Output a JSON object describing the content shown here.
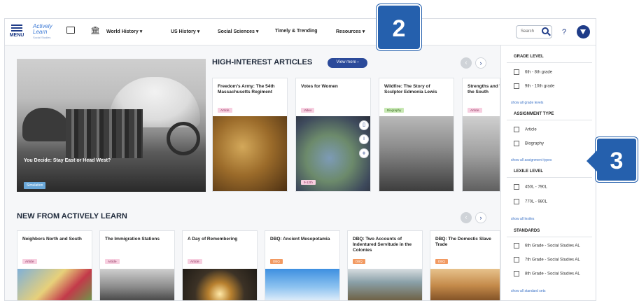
{
  "navbar": {
    "menu_label": "MENU",
    "logo_line1": "Actively",
    "logo_line2": "Learn",
    "logo_sub": "Social Studies",
    "links": [
      "World History ▾",
      "US History ▾",
      "Social Sciences ▾",
      "Timely & Trending",
      "Resources ▾"
    ],
    "search_placeholder": "Search",
    "help": "?"
  },
  "hero": {
    "title": "You Decide: Stay East or Head West?",
    "tag": "Simulation"
  },
  "high_interest": {
    "title": "HIGH-INTEREST ARTICLES",
    "view_more": "View more  ›",
    "prev": "‹",
    "next": "›",
    "cards": [
      {
        "title": "Freedom's Army: The 54th Massachusetts Regiment",
        "tag": "Article"
      },
      {
        "title": "Votes for Women",
        "tag": "Video",
        "grade": "9-12th"
      },
      {
        "title": "Wildfire: The Story of Sculptor Edmonia Lewis",
        "tag": "Biography"
      },
      {
        "title": "Strengths and Weaknesses of the South",
        "tag": "Article"
      }
    ]
  },
  "new_from": {
    "title": "NEW FROM ACTIVELY LEARN",
    "prev": "‹",
    "next": "›",
    "cards": [
      {
        "title": "Neighbors North and South",
        "tag": "Article"
      },
      {
        "title": "The Immigration Stations",
        "tag": "Article"
      },
      {
        "title": "A Day of Remembering",
        "tag": "Article"
      },
      {
        "title": "DBQ: Ancient Mesopotamia",
        "tag": "DBQ"
      },
      {
        "title": "DBQ: Two Accounts of Indentured Servitude in the Colonies",
        "tag": "DBQ"
      },
      {
        "title": "DBQ: The Domestic Slave Trade",
        "tag": "DBQ"
      }
    ]
  },
  "sidebar": {
    "grade": {
      "head": "GRADE LEVEL",
      "items": [
        "6th - 8th grade",
        "9th - 10th grade"
      ],
      "link": "show all grade levels"
    },
    "type": {
      "head": "ASSIGNMENT TYPE",
      "items": [
        "Article",
        "Biography"
      ],
      "link": "show all assignment types"
    },
    "lexile": {
      "head": "LEXILE LEVEL",
      "items": [
        "450L - 790L",
        "770L - 980L"
      ],
      "link": "show all lexiles"
    },
    "standards": {
      "head": "STANDARDS",
      "items": [
        "6th Grade - Social Studies AL",
        "7th Grade - Social Studies AL",
        "8th Grade - Social Studies AL"
      ],
      "link": "show all standard sets"
    }
  },
  "callouts": {
    "badge_2": "2",
    "badge_3": "3"
  }
}
